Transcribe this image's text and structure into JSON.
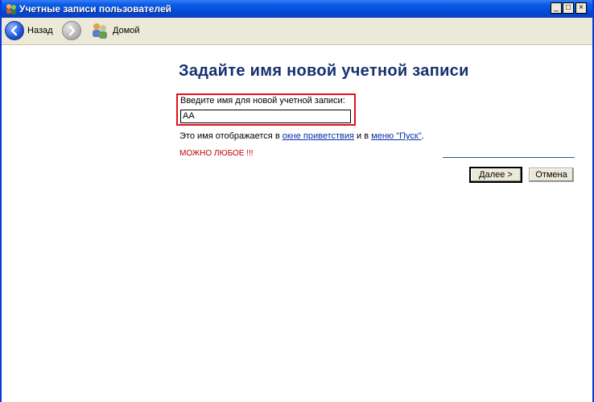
{
  "window": {
    "title": "Учетные записи пользователей",
    "controls": [
      "_",
      "□",
      "×"
    ]
  },
  "toolbar": {
    "back_label": "Назад",
    "home_label": "Домой"
  },
  "page": {
    "heading": "Задайте имя новой учетной записи",
    "field_label": "Введите имя для новой учетной записи:",
    "field_value": "АА",
    "hint_prefix": "Это имя отображается в ",
    "hint_link1": "окне приветствия",
    "hint_middle": " и в ",
    "hint_link2": "меню \"Пуск\"",
    "hint_suffix": ".",
    "note": "МОЖНО ЛЮБОЕ !!!"
  },
  "buttons": {
    "next": "Далее >",
    "cancel": "Отмена"
  },
  "colors": {
    "accent": "#15326f",
    "highlight_border": "#e0141b",
    "note": "#c00000"
  }
}
